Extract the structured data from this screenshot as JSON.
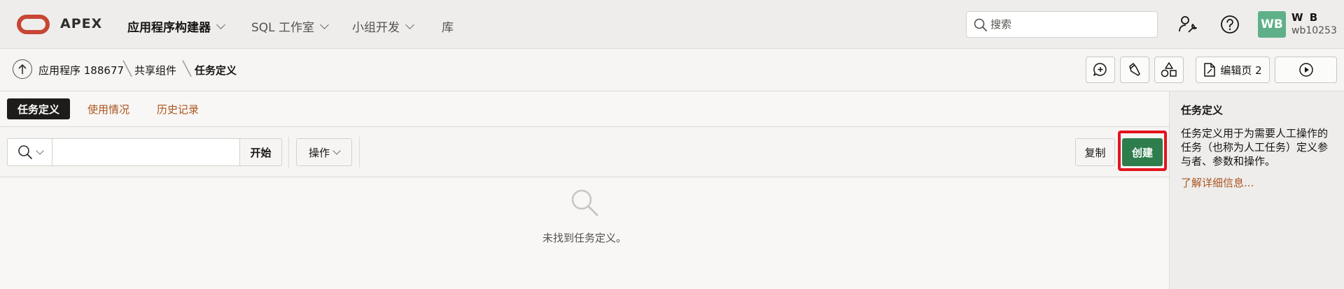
{
  "header": {
    "logo_text": "APEX",
    "nav": [
      {
        "label": "应用程序构建器",
        "has_menu": true,
        "active": true
      },
      {
        "label": "SQL 工作室",
        "has_menu": true,
        "active": false
      },
      {
        "label": "小组开发",
        "has_menu": true,
        "active": false
      },
      {
        "label": "库",
        "has_menu": false,
        "active": false
      }
    ],
    "search_placeholder": "搜索",
    "user": {
      "initials": "WB",
      "name": "W B",
      "id": "wb10253"
    },
    "colors": {
      "brand_red": "#c74634",
      "avatar": "#5fb088"
    }
  },
  "breadcrumb": {
    "items": [
      "应用程序 188677",
      "共享组件",
      "任务定义"
    ],
    "edit_page_label": "编辑页 2"
  },
  "tabs": [
    "任务定义",
    "使用情况",
    "历史记录"
  ],
  "toolbar": {
    "go_label": "开始",
    "actions_label": "操作",
    "copy_label": "复制",
    "create_label": "创建",
    "create_color": "#2e7d4d",
    "highlight_color": "#e3131e"
  },
  "empty_message": "未找到任务定义。",
  "help": {
    "title": "任务定义",
    "body": "任务定义用于为需要人工操作的任务（也称为人工任务）定义参与者、参数和操作。",
    "link": "了解详细信息..."
  }
}
